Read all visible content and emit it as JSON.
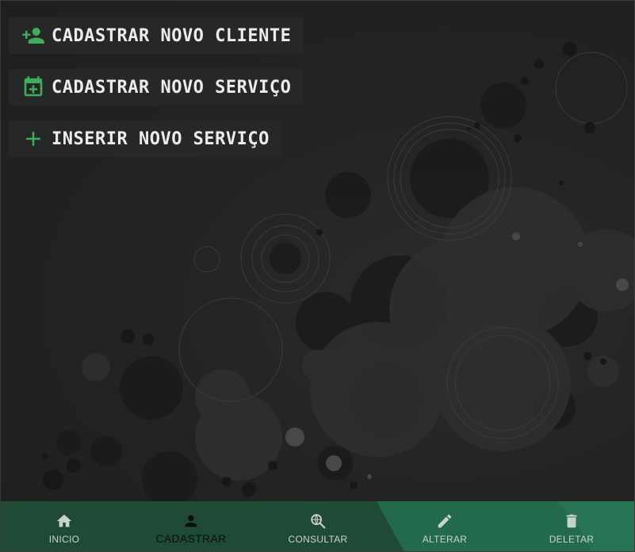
{
  "actions": [
    {
      "label": "CADASTRAR NOVO CLIENTE",
      "icon": "person-add-icon"
    },
    {
      "label": "CADASTRAR NOVO SERVIÇO",
      "icon": "calendar-add-icon"
    },
    {
      "label": "INSERIR NOVO SERVIÇO",
      "icon": "plus-icon"
    }
  ],
  "nav": {
    "items": [
      {
        "label": "INICIO",
        "icon": "home-icon",
        "active": false
      },
      {
        "label": "CADASTRAR",
        "icon": "person-icon",
        "active": true
      },
      {
        "label": "CONSULTAR",
        "icon": "search-globe-icon",
        "active": false
      },
      {
        "label": "ALTERAR",
        "icon": "pencil-icon",
        "active": false
      },
      {
        "label": "DELETAR",
        "icon": "trash-icon",
        "active": false
      }
    ]
  },
  "colors": {
    "accent_green": "#3fae5a",
    "nav_bg": "#1f4a36",
    "background": "#1f2120"
  }
}
